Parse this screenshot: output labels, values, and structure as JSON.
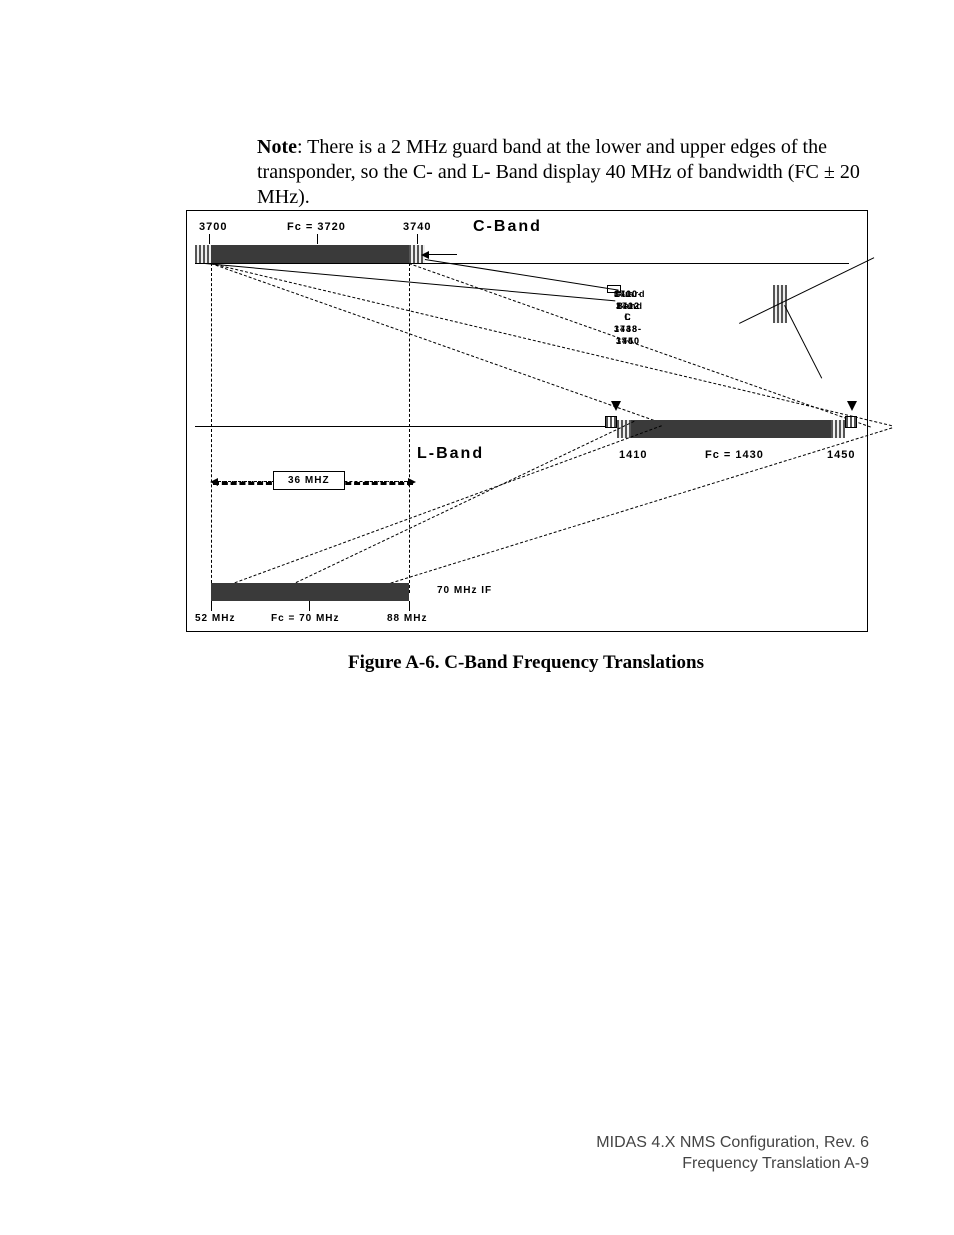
{
  "note_bold": "Note",
  "note_text": ": There is a 2 MHz guard band at the lower and upper edges of the transponder, so the C- and L- Band display 40 MHz of bandwidth (FC ± 20 MHz).",
  "c": {
    "l": "3700",
    "fc": "Fc = 3720",
    "r": "3740",
    "title": "C-Band"
  },
  "l": {
    "l": "1410",
    "fc": "Fc = 1430",
    "r": "1450",
    "title": "L-Band"
  },
  "if": {
    "l": "52 MHz",
    "fc": "Fc = 70 MHz",
    "r": "88 MHz",
    "title": "70 MHz IF"
  },
  "mhz36": "36 MHZ",
  "gb": {
    "t": "Guard Band",
    "c": "3700-3702   C   3738-3740",
    "l": "1410-1412    L    1448-1450"
  },
  "caption": "Figure A-6.  C-Band Frequency Translations",
  "foot1": "MIDAS 4.X NMS Configuration,   Rev. 6",
  "foot2": "Frequency Translation         A-9"
}
